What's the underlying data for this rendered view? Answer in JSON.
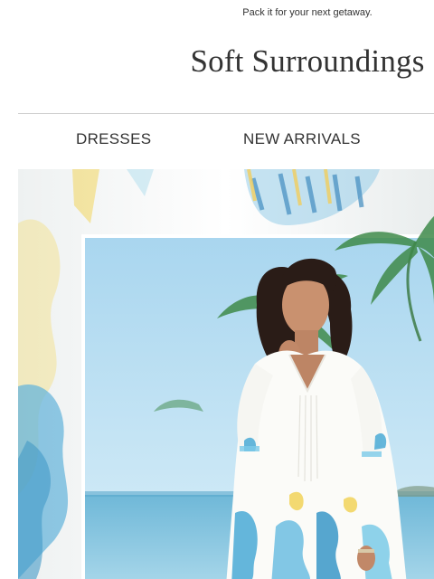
{
  "preheader": {
    "text": "Pack it for your next getaway."
  },
  "brand": {
    "name": "Soft Surroundings"
  },
  "nav": {
    "items": [
      {
        "label": "DRESSES"
      },
      {
        "label": "NEW ARRIVALS"
      }
    ]
  },
  "hero": {
    "image_icon": "model-in-tropical-print-tunic-photo"
  },
  "colors": {
    "text": "#333333",
    "divider": "#cfcfcf",
    "sky": "#bfe0f1",
    "sea": "#7fc1dc",
    "aqua_print": "#4aaad6",
    "yellow_print": "#f2d45a"
  }
}
